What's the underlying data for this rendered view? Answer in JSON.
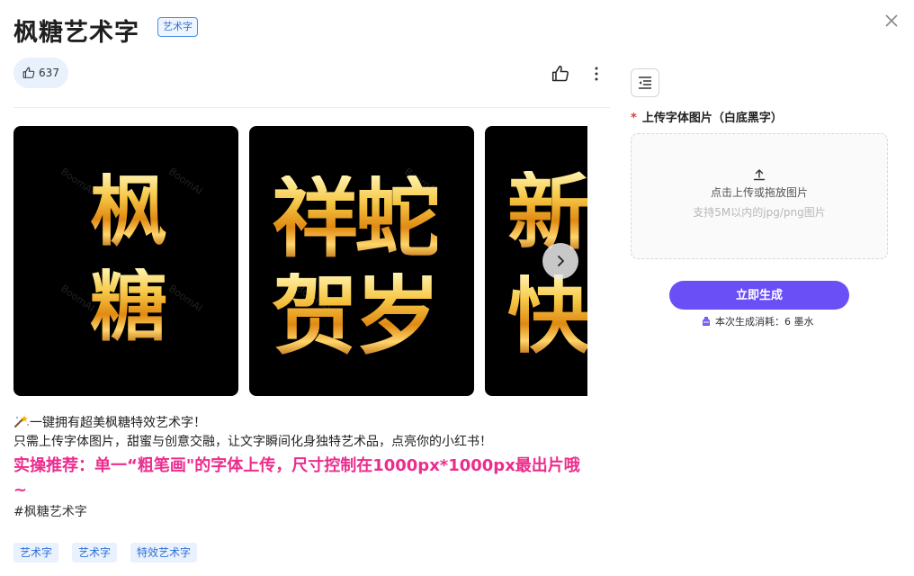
{
  "header": {
    "title": "枫糖艺术字",
    "tag": "艺术字"
  },
  "stats": {
    "like_count": "637"
  },
  "gallery": {
    "cards": [
      {
        "lines": [
          "枫",
          "糖"
        ],
        "watermark": "BoomAI"
      },
      {
        "lines": [
          "祥蛇",
          "贺岁"
        ],
        "watermark": "BoomAI"
      },
      {
        "lines": [
          "新",
          "快"
        ],
        "watermark": ""
      }
    ]
  },
  "description": {
    "line1": "一键拥有超美枫糖特效艺术字！",
    "line2": "只需上传字体图片，甜蜜与创意交融，让文字瞬间化身独特艺术品，点亮你的小红书！",
    "tip": "实操推荐：单一“粗笔画\"的字体上传，尺寸控制在1000px*1000px最出片哦~",
    "hashtag": "#枫糖艺术字"
  },
  "tags": [
    "艺术字",
    "艺术字",
    "特效艺术字"
  ],
  "panel": {
    "upload_label": "上传字体图片（白底黑字）",
    "required_mark": "*",
    "upload_main": "点击上传或拖放图片",
    "upload_sub": "支持5M以内的jpg/png图片",
    "generate_button": "立即生成",
    "cost_text": "本次生成消耗：6 墨水"
  },
  "colors": {
    "accent": "#6a4ff7",
    "tip_pink": "#ec2d8d",
    "tag_blue": "#2f6fd6"
  }
}
